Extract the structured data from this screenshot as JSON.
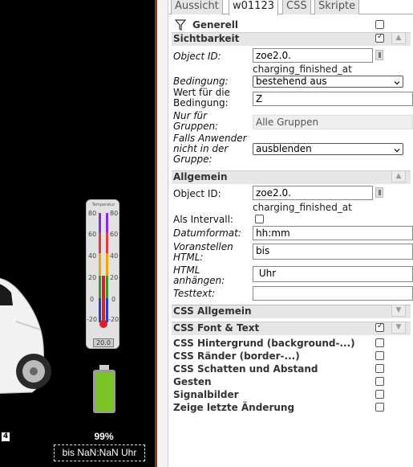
{
  "canvas": {
    "battery_percent_text": "99%",
    "time_text": "bis NaN:NaN Uhr",
    "thermo": {
      "title": "Temperatur",
      "ticks_left": [
        "80",
        "60",
        "40",
        "20",
        "0",
        "-20"
      ],
      "ticks_right": [
        "80",
        "60",
        "40",
        "20",
        "0",
        "-20"
      ],
      "value": "20.0"
    },
    "badge_text": "4",
    "battery_level": 0.99
  },
  "tabs": [
    "Aussicht",
    "w01123",
    "CSS",
    "Skripte"
  ],
  "generell": {
    "title": "Generell"
  },
  "sichtbarkeit": {
    "title": "Sichtbarkeit",
    "object_id_label": "Object ID:",
    "object_id_value": "zoe2.0.",
    "object_id_note": "charging_finished_at",
    "condition_label": "Bedingung:",
    "condition_value": "bestehend aus",
    "condition_value_label": "Wert für die Bedingung:",
    "condition_value_value": "Z",
    "groups_label": "Nur für Gruppen:",
    "groups_value": "Alle Gruppen",
    "not_in_group_label": "Falls Anwender nicht in der Gruppe:",
    "not_in_group_value": "ausblenden"
  },
  "allgemein": {
    "title": "Allgemein",
    "object_id_label": "Object ID:",
    "object_id_value": "zoe2.0.",
    "object_id_note": "charging_finished_at",
    "interval_label": "Als Intervall:",
    "date_format_label": "Datumformat:",
    "date_format_value": "hh:mm",
    "prepend_label": "Voranstellen HTML:",
    "prepend_value": "bis",
    "append_label": "HTML anhängen:",
    "append_value": " Uhr",
    "test_label": "Testtext:",
    "test_value": ""
  },
  "css_sections": [
    "CSS Allgemein",
    "CSS Font & Text",
    "CSS Hintergrund (background-...)",
    "CSS Ränder (border-...)",
    "CSS Schatten und Abstand",
    "Gesten",
    "Signalbilder",
    "Zeige letzte Änderung"
  ]
}
